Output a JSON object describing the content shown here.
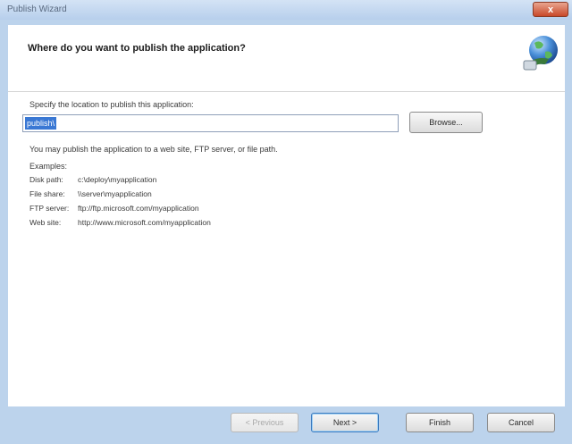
{
  "window": {
    "title": "Publish Wizard",
    "close_label": "x"
  },
  "header": {
    "title": "Where do you want to publish the application?",
    "icon": "globe-icon"
  },
  "location": {
    "prompt": "Specify the location to publish this application:",
    "value": "publish\\",
    "browse_label": "Browse..."
  },
  "info": {
    "description": "You may publish the application to a web site, FTP server, or file path.",
    "examples_label": "Examples:",
    "examples": [
      {
        "term": "Disk path:",
        "value": "c:\\deploy\\myapplication"
      },
      {
        "term": "File share:",
        "value": "\\\\server\\myapplication"
      },
      {
        "term": "FTP server:",
        "value": "ftp://ftp.microsoft.com/myapplication"
      },
      {
        "term": "Web site:",
        "value": "http://www.microsoft.com/myapplication"
      }
    ]
  },
  "buttons": {
    "previous": "< Previous",
    "next": "Next >",
    "finish": "Finish",
    "cancel": "Cancel"
  }
}
